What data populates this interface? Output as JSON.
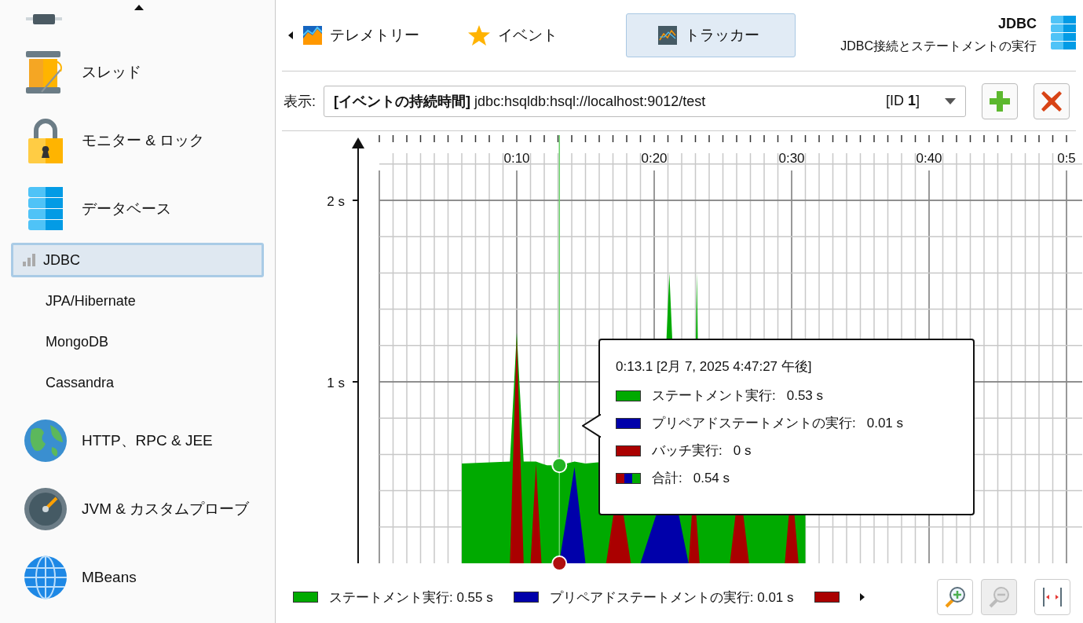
{
  "sidebar": {
    "items": [
      {
        "label": "スレッド",
        "selected": false
      },
      {
        "label": "モニター & ロック",
        "selected": false
      },
      {
        "label": "データベース",
        "selected": false,
        "children": [
          {
            "label": "JDBC",
            "selected": true
          },
          {
            "label": "JPA/Hibernate",
            "selected": false
          },
          {
            "label": "MongoDB",
            "selected": false
          },
          {
            "label": "Cassandra",
            "selected": false
          }
        ]
      },
      {
        "label": "HTTP、RPC & JEE",
        "selected": false
      },
      {
        "label": "JVM & カスタムプローブ",
        "selected": false
      },
      {
        "label": "MBeans",
        "selected": false
      }
    ]
  },
  "tabs": [
    {
      "label": "テレメトリー",
      "selected": false
    },
    {
      "label": "イベント",
      "selected": false
    },
    {
      "label": "トラッカー",
      "selected": true
    }
  ],
  "header": {
    "title": "JDBC",
    "subtitle": "JDBC接続とステートメントの実行"
  },
  "selector": {
    "label": "表示:",
    "value": "**[イベントの持続時間]** jdbc:hsqldb:hsql://localhost:9012/test",
    "id": "[ID **1**]"
  },
  "chart": {
    "separator": ":",
    "x_ticks": [
      "0:10",
      "0:20",
      "0:30",
      "0:40",
      "0:5"
    ],
    "y_ticks": [
      "2 s",
      "1 s"
    ],
    "series": [
      {
        "name": "ステートメント実行",
        "color": "#00aa00"
      },
      {
        "name": "プリペアドステートメントの実行",
        "color": "#0000aa"
      },
      {
        "name": "バッチ実行",
        "color": "#aa0000"
      }
    ],
    "tooltip": {
      "title": "0:13.1 [2月 7, 2025 4:47:27 午後]",
      "rows": [
        {
          "kind": "series",
          "value": "0.53 s"
        },
        {
          "kind": "series",
          "value": "0.01 s"
        },
        {
          "kind": "series",
          "value": "0 s"
        },
        {
          "kind": "total",
          "label": "合計",
          "value": "0.54 s"
        }
      ]
    },
    "legend": {
      "labels": [
        "ステートメント実行: 0.55 s",
        "プリペアドステートメントの実行: 0.01 s"
      ]
    }
  }
}
